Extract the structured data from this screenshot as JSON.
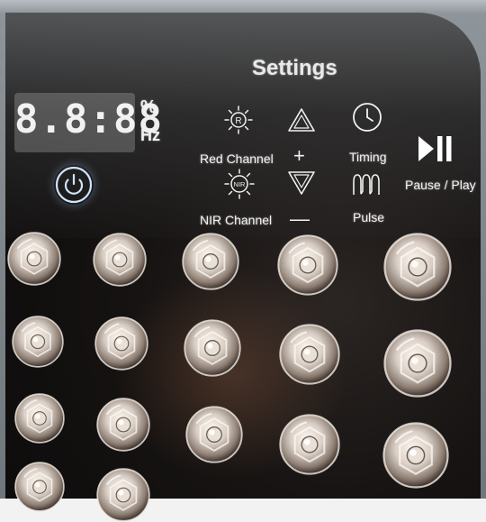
{
  "panel": {
    "title": "Settings",
    "display": {
      "value": "8.8:88"
    },
    "units": {
      "percent": "%",
      "hz": "Hz"
    },
    "labels": {
      "red_channel": "Red Channel",
      "nir_channel": "NIR Channel",
      "timing": "Timing",
      "pulse": "Pulse",
      "pause_play": "Pause / Play"
    },
    "icons": {
      "red_sun": "R",
      "nir_sun": "NIR",
      "plus": "+",
      "minus": "—"
    }
  },
  "colors": {
    "panel_dark": "#0b0a0a",
    "panel_text": "#f2f2f2",
    "power_ring": "#cfe3ff",
    "frame": "#8d9499"
  }
}
